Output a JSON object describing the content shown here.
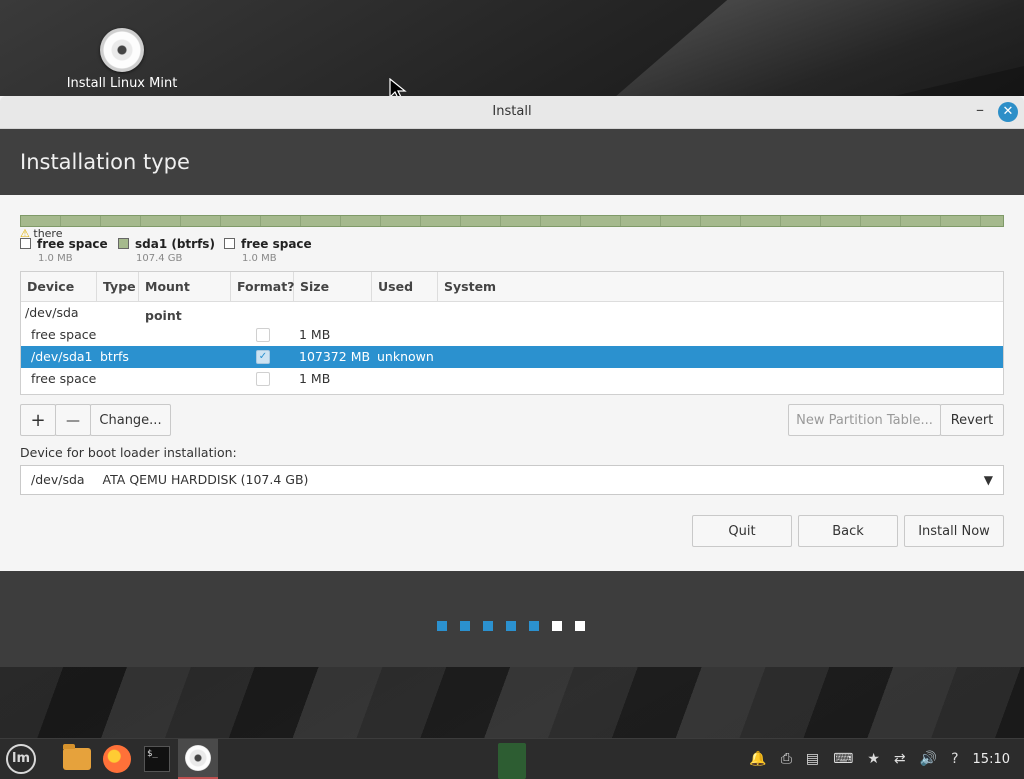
{
  "desktop": {
    "icon_label": "Install Linux Mint"
  },
  "window": {
    "title": "Install",
    "minimize_symbol": "–",
    "close_symbol": "✕",
    "header_title": "Installation type"
  },
  "disk": {
    "warning_text": "there",
    "legend": [
      {
        "name": "free space",
        "size": "1.0 MB",
        "color": "#ffffff"
      },
      {
        "name": "sda1 (btrfs)",
        "size": "107.4 GB",
        "color": "#a5b98d"
      },
      {
        "name": "free space",
        "size": "1.0 MB",
        "color": "#ffffff"
      }
    ]
  },
  "table": {
    "headers": [
      "Device",
      "Type",
      "Mount point",
      "Format?",
      "Size",
      "Used",
      "System"
    ],
    "rows": [
      {
        "device": "/dev/sda",
        "type": "",
        "mount": "",
        "format": null,
        "size": "",
        "used": "",
        "system": ""
      },
      {
        "device": "free space",
        "type": "",
        "mount": "",
        "format": false,
        "size": "1 MB",
        "used": "",
        "system": ""
      },
      {
        "device": "/dev/sda1",
        "type": "btrfs",
        "mount": "",
        "format": true,
        "size": "107372 MB",
        "used": "unknown",
        "system": ""
      },
      {
        "device": "free space",
        "type": "",
        "mount": "",
        "format": false,
        "size": "1 MB",
        "used": "",
        "system": ""
      }
    ]
  },
  "buttons": {
    "add": "+",
    "remove": "—",
    "change": "Change...",
    "new_partition_table": "New Partition Table...",
    "revert": "Revert",
    "quit": "Quit",
    "back": "Back",
    "install_now": "Install Now"
  },
  "bootloader": {
    "label": "Device for boot loader installation:",
    "selected_device": "/dev/sda",
    "selected_desc": "ATA QEMU HARDDISK (107.4 GB)"
  },
  "progress": {
    "total_steps": 7,
    "completed_steps": 5,
    "accent": "#2b91cf"
  },
  "taskbar": {
    "menu_logo_text": "lm",
    "terminal_text": "$_",
    "clock": "15:10",
    "tray_icons": [
      "bell-icon",
      "printer-icon",
      "clipboard-icon",
      "keyboard-icon",
      "star-icon",
      "network-icon",
      "volume-icon",
      "help-icon"
    ]
  }
}
